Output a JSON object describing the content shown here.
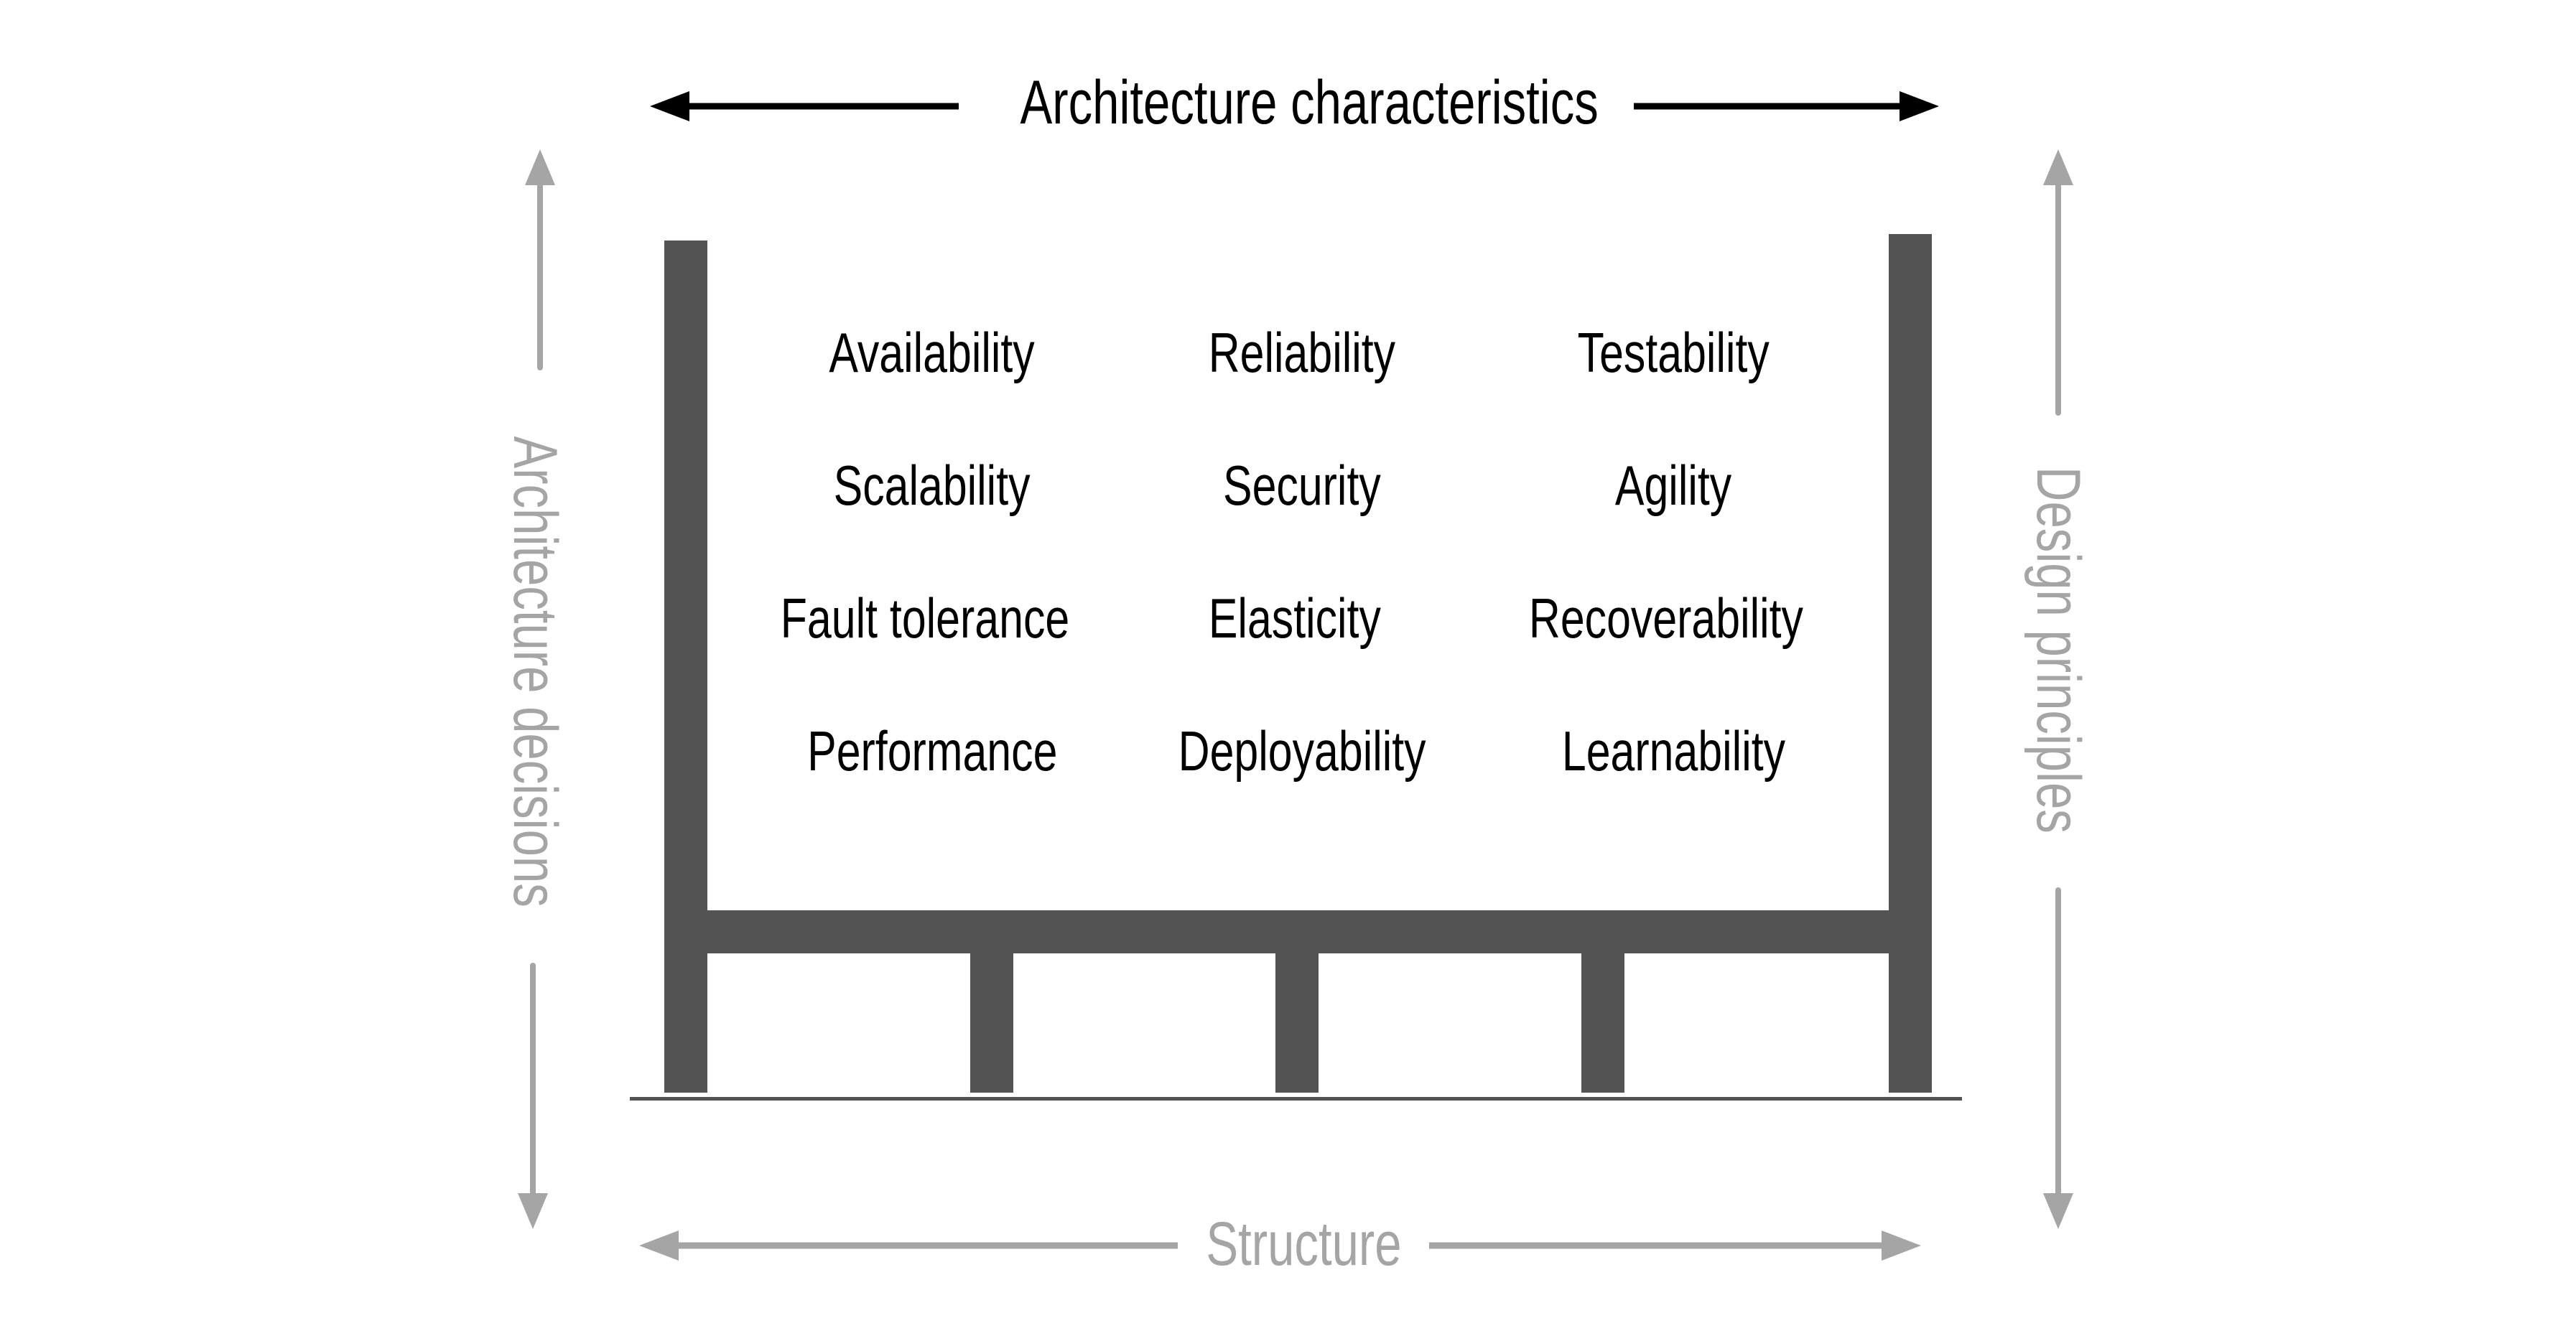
{
  "diagram": {
    "top_label": "Architecture characteristics",
    "left_label": "Architecture decisions",
    "right_label": "Design principles",
    "bottom_label": "Structure",
    "characteristics": [
      [
        "Availability",
        "Reliability",
        "Testability"
      ],
      [
        "Scalability",
        "Security",
        "Agility"
      ],
      [
        "Fault tolerance",
        "Elasticity",
        "Recoverability"
      ],
      [
        "Performance",
        "Deployability",
        "Learnability"
      ]
    ],
    "colors": {
      "structure": "#535353",
      "primary_text": "#000000",
      "secondary": "#a5a5a5"
    }
  }
}
